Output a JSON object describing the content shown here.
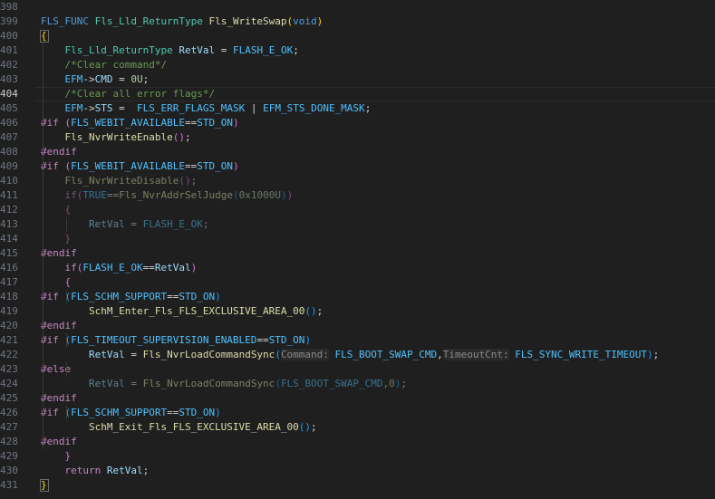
{
  "editor": {
    "active_line": "404",
    "lines": [
      {
        "n": "398",
        "tokens": []
      },
      {
        "n": "399",
        "tokens": [
          [
            "t-kw",
            "FLS_FUNC"
          ],
          [
            "t-op",
            " "
          ],
          [
            "t-type",
            "Fls_Lld_ReturnType"
          ],
          [
            "t-op",
            " "
          ],
          [
            "t-fn",
            "Fls_WriteSwap"
          ],
          [
            "t-br",
            "("
          ],
          [
            "t-kw",
            "void"
          ],
          [
            "t-br",
            ")"
          ]
        ]
      },
      {
        "n": "400",
        "tokens": [
          [
            "t-br",
            "{"
          ]
        ]
      },
      {
        "n": "401",
        "tokens": [
          [
            "t-op",
            "    "
          ],
          [
            "t-type",
            "Fls_Lld_ReturnType"
          ],
          [
            "t-op",
            " "
          ],
          [
            "t-var",
            "RetVal"
          ],
          [
            "t-op",
            " = "
          ],
          [
            "t-mac",
            "FLASH_E_OK"
          ],
          [
            "t-op",
            ";"
          ]
        ]
      },
      {
        "n": "402",
        "tokens": [
          [
            "t-op",
            "    "
          ],
          [
            "t-cm",
            "/*Clear command*/"
          ]
        ]
      },
      {
        "n": "403",
        "tokens": [
          [
            "t-op",
            "    "
          ],
          [
            "t-mac",
            "EFM"
          ],
          [
            "t-op",
            "->"
          ],
          [
            "t-var",
            "CMD"
          ],
          [
            "t-op",
            " = "
          ],
          [
            "t-num",
            "0U"
          ],
          [
            "t-op",
            ";"
          ]
        ]
      },
      {
        "n": "404",
        "tokens": [
          [
            "t-op",
            "    "
          ],
          [
            "t-cm",
            "/*Clear all error flags*/"
          ]
        ]
      },
      {
        "n": "405",
        "tokens": [
          [
            "t-op",
            "    "
          ],
          [
            "t-mac",
            "EFM"
          ],
          [
            "t-op",
            "->"
          ],
          [
            "t-var",
            "STS"
          ],
          [
            "t-op",
            " =  "
          ],
          [
            "t-mac",
            "FLS_ERR_FLAGS_MASK"
          ],
          [
            "t-op",
            " | "
          ],
          [
            "t-mac",
            "EFM_STS_DONE_MASK"
          ],
          [
            "t-op",
            ";"
          ]
        ]
      },
      {
        "n": "406",
        "tokens": [
          [
            "t-ctl",
            "#if"
          ],
          [
            "t-op",
            " "
          ],
          [
            "t-br2",
            "("
          ],
          [
            "t-mac",
            "FLS_WEBIT_AVAILABLE"
          ],
          [
            "t-op",
            "=="
          ],
          [
            "t-mac",
            "STD_ON"
          ],
          [
            "t-br2",
            ")"
          ]
        ]
      },
      {
        "n": "407",
        "tokens": [
          [
            "t-op",
            "    "
          ],
          [
            "t-fn",
            "Fls_NvrWriteEnable"
          ],
          [
            "t-br2",
            "()"
          ],
          [
            "t-op",
            ";"
          ]
        ]
      },
      {
        "n": "408",
        "tokens": [
          [
            "t-ctl",
            "#endif"
          ]
        ]
      },
      {
        "n": "409",
        "tokens": [
          [
            "t-ctl",
            "#if"
          ],
          [
            "t-op",
            " "
          ],
          [
            "t-br2",
            "("
          ],
          [
            "t-mac",
            "FLS_WEBIT_AVAILABLE"
          ],
          [
            "t-op",
            "=="
          ],
          [
            "t-mac",
            "STD_ON"
          ],
          [
            "t-br2",
            ")"
          ]
        ]
      },
      {
        "n": "410",
        "dim": true,
        "tokens": [
          [
            "t-op",
            "    "
          ],
          [
            "t-fn",
            "Fls_NvrWriteDisable"
          ],
          [
            "t-br2",
            "()"
          ],
          [
            "t-op",
            ";"
          ]
        ]
      },
      {
        "n": "411",
        "dim": true,
        "tokens": [
          [
            "t-op",
            "    "
          ],
          [
            "t-ctl",
            "if"
          ],
          [
            "t-br2",
            "("
          ],
          [
            "t-mac",
            "TRUE"
          ],
          [
            "t-op",
            "=="
          ],
          [
            "t-fn",
            "Fls_NvrAddrSelJudge"
          ],
          [
            "t-br3",
            "("
          ],
          [
            "t-num",
            "0x1000U"
          ],
          [
            "t-br3",
            ")"
          ],
          [
            "t-br2",
            ")"
          ]
        ]
      },
      {
        "n": "412",
        "dim": true,
        "tokens": [
          [
            "t-op",
            "    "
          ],
          [
            "t-br2",
            "{"
          ]
        ]
      },
      {
        "n": "413",
        "dim": true,
        "tokens": [
          [
            "t-op",
            "        "
          ],
          [
            "t-var",
            "RetVal"
          ],
          [
            "t-op",
            " = "
          ],
          [
            "t-mac",
            "FLASH_E_OK"
          ],
          [
            "t-op",
            ";"
          ]
        ]
      },
      {
        "n": "414",
        "dim": true,
        "tokens": [
          [
            "t-op",
            "    "
          ],
          [
            "t-br2",
            "}"
          ]
        ]
      },
      {
        "n": "415",
        "tokens": [
          [
            "t-ctl",
            "#endif"
          ]
        ]
      },
      {
        "n": "416",
        "tokens": [
          [
            "t-op",
            "    "
          ],
          [
            "t-ctl",
            "if"
          ],
          [
            "t-br2",
            "("
          ],
          [
            "t-mac",
            "FLASH_E_OK"
          ],
          [
            "t-op",
            "=="
          ],
          [
            "t-var",
            "RetVal"
          ],
          [
            "t-br2",
            ")"
          ]
        ]
      },
      {
        "n": "417",
        "tokens": [
          [
            "t-op",
            "    "
          ],
          [
            "t-br2",
            "{"
          ]
        ]
      },
      {
        "n": "418",
        "tokens": [
          [
            "t-ctl",
            "#if"
          ],
          [
            "t-op",
            " "
          ],
          [
            "t-br3",
            "("
          ],
          [
            "t-mac",
            "FLS_SCHM_SUPPORT"
          ],
          [
            "t-op",
            "=="
          ],
          [
            "t-mac",
            "STD_ON"
          ],
          [
            "t-br3",
            ")"
          ]
        ]
      },
      {
        "n": "419",
        "tokens": [
          [
            "t-op",
            "        "
          ],
          [
            "t-fn",
            "SchM_Enter_Fls_FLS_EXCLUSIVE_AREA_00"
          ],
          [
            "t-br3",
            "()"
          ],
          [
            "t-op",
            ";"
          ]
        ]
      },
      {
        "n": "420",
        "tokens": [
          [
            "t-ctl",
            "#endif"
          ]
        ]
      },
      {
        "n": "421",
        "tokens": [
          [
            "t-ctl",
            "#if"
          ],
          [
            "t-op",
            " "
          ],
          [
            "t-br3",
            "("
          ],
          [
            "t-mac",
            "FLS_TIMEOUT_SUPERVISION_ENABLED"
          ],
          [
            "t-op",
            "=="
          ],
          [
            "t-mac",
            "STD_ON"
          ],
          [
            "t-br3",
            ")"
          ]
        ]
      },
      {
        "n": "422",
        "tokens": [
          [
            "t-op",
            "        "
          ],
          [
            "t-var",
            "RetVal"
          ],
          [
            "t-op",
            " = "
          ],
          [
            "t-fn",
            "Fls_NvrLoadCommandSync"
          ],
          [
            "t-br3",
            "("
          ],
          [
            "t-hint",
            "Command:"
          ],
          [
            "t-op",
            " "
          ],
          [
            "t-mac",
            "FLS_BOOT_SWAP_CMD"
          ],
          [
            "t-op",
            ","
          ],
          [
            "t-hint",
            "TimeoutCnt:"
          ],
          [
            "t-op",
            " "
          ],
          [
            "t-mac",
            "FLS_SYNC_WRITE_TIMEOUT"
          ],
          [
            "t-br3",
            ")"
          ],
          [
            "t-op",
            ";"
          ]
        ]
      },
      {
        "n": "423",
        "tokens": [
          [
            "t-ctl",
            "#else"
          ]
        ]
      },
      {
        "n": "424",
        "dim": true,
        "tokens": [
          [
            "t-op",
            "        "
          ],
          [
            "t-var",
            "RetVal"
          ],
          [
            "t-op",
            " = "
          ],
          [
            "t-fn",
            "Fls_NvrLoadCommandSync"
          ],
          [
            "t-br3",
            "("
          ],
          [
            "t-mac",
            "FLS_BOOT_SWAP_CMD"
          ],
          [
            "t-op",
            ","
          ],
          [
            "t-num",
            "0"
          ],
          [
            "t-br3",
            ")"
          ],
          [
            "t-op",
            ";"
          ]
        ]
      },
      {
        "n": "425",
        "tokens": [
          [
            "t-ctl",
            "#endif"
          ]
        ]
      },
      {
        "n": "426",
        "tokens": [
          [
            "t-ctl",
            "#if"
          ],
          [
            "t-op",
            " "
          ],
          [
            "t-br3",
            "("
          ],
          [
            "t-mac",
            "FLS_SCHM_SUPPORT"
          ],
          [
            "t-op",
            "=="
          ],
          [
            "t-mac",
            "STD_ON"
          ],
          [
            "t-br3",
            ")"
          ]
        ]
      },
      {
        "n": "427",
        "tokens": [
          [
            "t-op",
            "        "
          ],
          [
            "t-fn",
            "SchM_Exit_Fls_FLS_EXCLUSIVE_AREA_00"
          ],
          [
            "t-br3",
            "()"
          ],
          [
            "t-op",
            ";"
          ]
        ]
      },
      {
        "n": "428",
        "tokens": [
          [
            "t-ctl",
            "#endif"
          ]
        ]
      },
      {
        "n": "429",
        "tokens": [
          [
            "t-op",
            "    "
          ],
          [
            "t-br2",
            "}"
          ]
        ]
      },
      {
        "n": "430",
        "tokens": [
          [
            "t-op",
            "    "
          ],
          [
            "t-ctl",
            "return"
          ],
          [
            "t-op",
            " "
          ],
          [
            "t-var",
            "RetVal"
          ],
          [
            "t-op",
            ";"
          ]
        ]
      },
      {
        "n": "431",
        "tokens": [
          [
            "t-br",
            "}"
          ]
        ]
      }
    ]
  },
  "colors": {
    "background": "#1f1f1f",
    "line_number": "#6e7681",
    "active_line_number": "#cccccc"
  }
}
